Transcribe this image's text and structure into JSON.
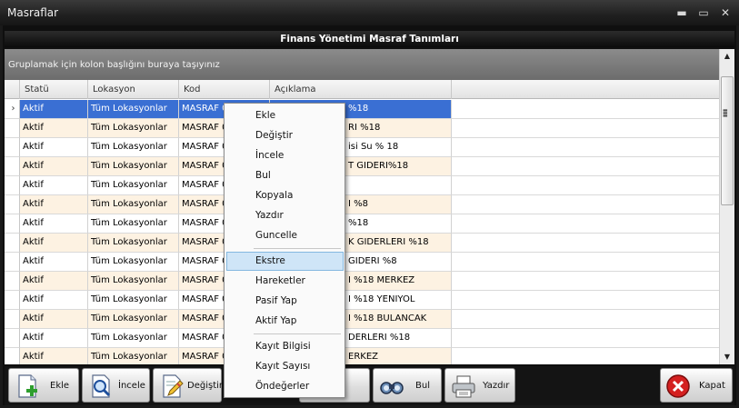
{
  "window": {
    "title": "Masraflar",
    "controls": {
      "minimize": "▬",
      "restore": "▭",
      "close": "✕"
    }
  },
  "banner": {
    "title": "Finans Yönetimi Masraf Tanımları"
  },
  "group_panel": {
    "hint": "Gruplamak için kolon başlığını buraya taşıyınız"
  },
  "grid": {
    "columns": [
      "Statü",
      "Lokasyon",
      "Kod",
      "Açıklama"
    ],
    "rows": [
      {
        "status": "Aktif",
        "location": "Tüm Lokasyonlar",
        "code": "MASRAF 0",
        "desc_tail": "%18",
        "selected": true
      },
      {
        "status": "Aktif",
        "location": "Tüm Lokasyonlar",
        "code": "MASRAF 0",
        "desc_tail": "RI %18"
      },
      {
        "status": "Aktif",
        "location": "Tüm Lokasyonlar",
        "code": "MASRAF 0",
        "desc_tail": "isi Su % 18"
      },
      {
        "status": "Aktif",
        "location": "Tüm Lokasyonlar",
        "code": "MASRAF 0",
        "desc_tail": "T GIDERI%18"
      },
      {
        "status": "Aktif",
        "location": "Tüm Lokasyonlar",
        "code": "MASRAF 0",
        "desc_tail": ""
      },
      {
        "status": "Aktif",
        "location": "Tüm Lokasyonlar",
        "code": "MASRAF 0",
        "desc_tail": "I %8"
      },
      {
        "status": "Aktif",
        "location": "Tüm Lokasyonlar",
        "code": "MASRAF 0",
        "desc_tail": "%18"
      },
      {
        "status": "Aktif",
        "location": "Tüm Lokasyonlar",
        "code": "MASRAF 0",
        "desc_tail": "K GIDERLERI %18"
      },
      {
        "status": "Aktif",
        "location": "Tüm Lokasyonlar",
        "code": "MASRAF 0",
        "desc_tail": "GIDERI %8"
      },
      {
        "status": "Aktif",
        "location": "Tüm Lokasyonlar",
        "code": "MASRAF 0",
        "desc_tail": "I %18 MERKEZ"
      },
      {
        "status": "Aktif",
        "location": "Tüm Lokasyonlar",
        "code": "MASRAF 0",
        "desc_tail": "I %18 YENIYOL"
      },
      {
        "status": "Aktif",
        "location": "Tüm Lokasyonlar",
        "code": "MASRAF 0",
        "desc_tail": "I %18 BULANCAK"
      },
      {
        "status": "Aktif",
        "location": "Tüm Lokasyonlar",
        "code": "MASRAF 0",
        "desc_tail": "DERLERI %18"
      },
      {
        "status": "Aktif",
        "location": "Tüm Lokasyonlar",
        "code": "MASRAF 0",
        "desc_tail": "ERKEZ"
      },
      {
        "status": "Aktif",
        "location": "Tüm Lokasyonlar",
        "code": "MASRAF 0",
        "desc_tail": ""
      }
    ],
    "row_indicator": "›"
  },
  "context_menu": {
    "items": [
      "Ekle",
      "Değiştir",
      "İncele",
      "Bul",
      "Kopyala",
      "Yazdır",
      "Guncelle",
      "Ekstre",
      "Hareketler",
      "Pasif Yap",
      "Aktif Yap",
      "Kayıt Bilgisi",
      "Kayıt Sayısı",
      "Öndeğerler"
    ],
    "hovered": "Ekstre"
  },
  "toolbar": {
    "buttons": [
      "Ekle",
      "İncele",
      "Değiştir",
      "Kopyala",
      "Bul",
      "Yazdır",
      "Kapat"
    ],
    "visible_kopyala_fragment": "opyala"
  },
  "scrollbar": {
    "up": "▲",
    "down": "▼"
  },
  "colors": {
    "selection": "#3a6fd3",
    "row_alt": "#fdf2e2",
    "menu_hover": "#cfe5f7",
    "title_bar": "#202020"
  }
}
